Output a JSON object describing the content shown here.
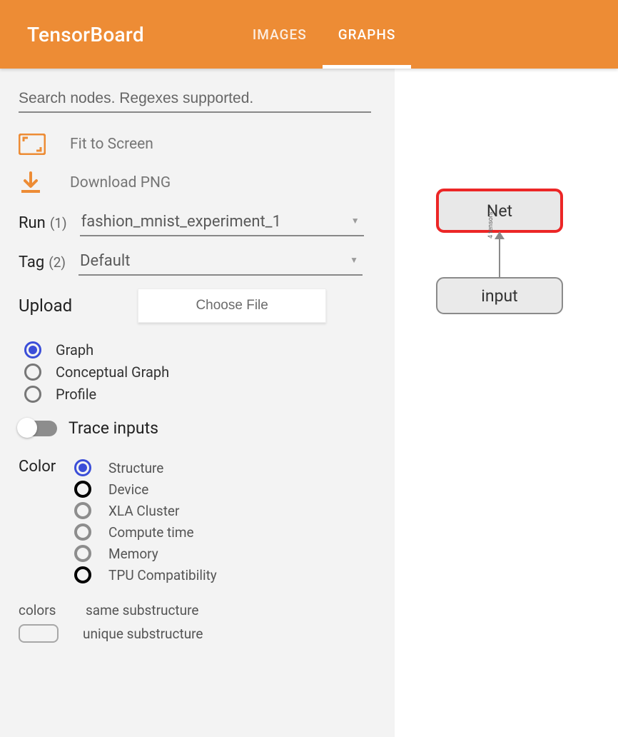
{
  "app_title": "TensorBoard",
  "tabs": [
    {
      "label": "IMAGES",
      "active": false
    },
    {
      "label": "GRAPHS",
      "active": true
    }
  ],
  "search": {
    "placeholder": "Search nodes. Regexes supported."
  },
  "actions": {
    "fit": "Fit to Screen",
    "download": "Download PNG"
  },
  "run": {
    "label": "Run",
    "count": "(1)",
    "value": "fashion_mnist_experiment_1"
  },
  "tag": {
    "label": "Tag",
    "count": "(2)",
    "value": "Default"
  },
  "upload": {
    "label": "Upload",
    "button": "Choose File"
  },
  "graph_type": [
    {
      "label": "Graph",
      "checked": true
    },
    {
      "label": "Conceptual Graph",
      "checked": false
    },
    {
      "label": "Profile",
      "checked": false
    }
  ],
  "trace_toggle": {
    "label": "Trace inputs",
    "on": false
  },
  "color": {
    "title": "Color",
    "options": [
      {
        "label": "Structure",
        "checked": true,
        "ring": "blue"
      },
      {
        "label": "Device",
        "checked": false,
        "ring": "bold"
      },
      {
        "label": "XLA Cluster",
        "checked": false,
        "ring": "grey"
      },
      {
        "label": "Compute time",
        "checked": false,
        "ring": "grey"
      },
      {
        "label": "Memory",
        "checked": false,
        "ring": "grey"
      },
      {
        "label": "TPU Compatibility",
        "checked": false,
        "ring": "bold"
      }
    ]
  },
  "legend": {
    "label": "colors",
    "rows": [
      "same substructure",
      "unique substructure"
    ]
  },
  "graph": {
    "nodes": {
      "net": "Net",
      "input": "input"
    },
    "edge_label": "4 tensors"
  }
}
